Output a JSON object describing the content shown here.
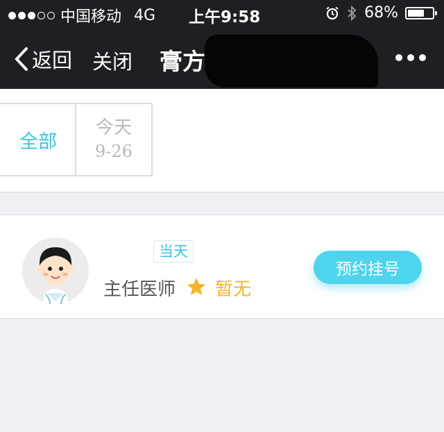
{
  "status_bar": {
    "carrier": "中国移动",
    "network": "4G",
    "time": "上午9:58",
    "battery_text": "68%",
    "battery_level": 0.68
  },
  "nav": {
    "back_label": "返回",
    "close_label": "关闭",
    "title": "膏方"
  },
  "date_tabs": {
    "all_label": "全部",
    "today_label": "今天",
    "today_date": "9-26"
  },
  "doctor": {
    "day_badge": "当天",
    "title": "主任医师",
    "rating_text": "暂无",
    "book_label": "预约挂号"
  },
  "colors": {
    "accent": "#3cc3e0",
    "button": "#4fd4ee",
    "rating": "#f2b52a",
    "navbar": "#1f1f23"
  }
}
